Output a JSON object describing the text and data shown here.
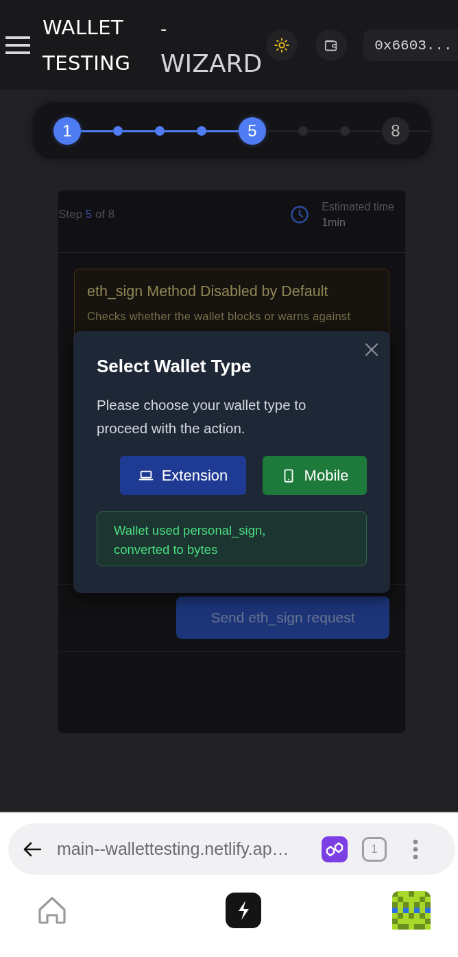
{
  "header": {
    "title_main": "WALLET TESTING",
    "title_sub_dash": "-",
    "title_sub": "WIZARD",
    "address": "0x6603..."
  },
  "stepper": [
    {
      "label": "1",
      "reached": true
    },
    {
      "reached": true
    },
    {
      "reached": true
    },
    {
      "reached": true
    },
    {
      "label": "5",
      "reached": true
    },
    {
      "reached": false
    },
    {
      "reached": false
    },
    {
      "label": "8",
      "reached": false
    }
  ],
  "step_counter": {
    "prefix": "Step",
    "current": "5",
    "suffix": "of 8"
  },
  "estimate": {
    "label": "Estimated time",
    "value": "1min"
  },
  "test": {
    "title": "eth_sign Method Disabled by Default",
    "description": "Checks whether the wallet blocks or warns against"
  },
  "send_button": "Send eth_sign request",
  "modal": {
    "title": "Select Wallet Type",
    "text": "Please choose your wallet type to proceed with the action.",
    "options": [
      {
        "kind": "extension",
        "label": "Extension"
      },
      {
        "kind": "mobile",
        "label": "Mobile"
      }
    ],
    "status": {
      "kind": "success",
      "text": "Wallet used personal_sign, converted to bytes"
    }
  },
  "browser": {
    "url": "main--wallettesting.netlify.ap…",
    "tab_count": "1"
  }
}
